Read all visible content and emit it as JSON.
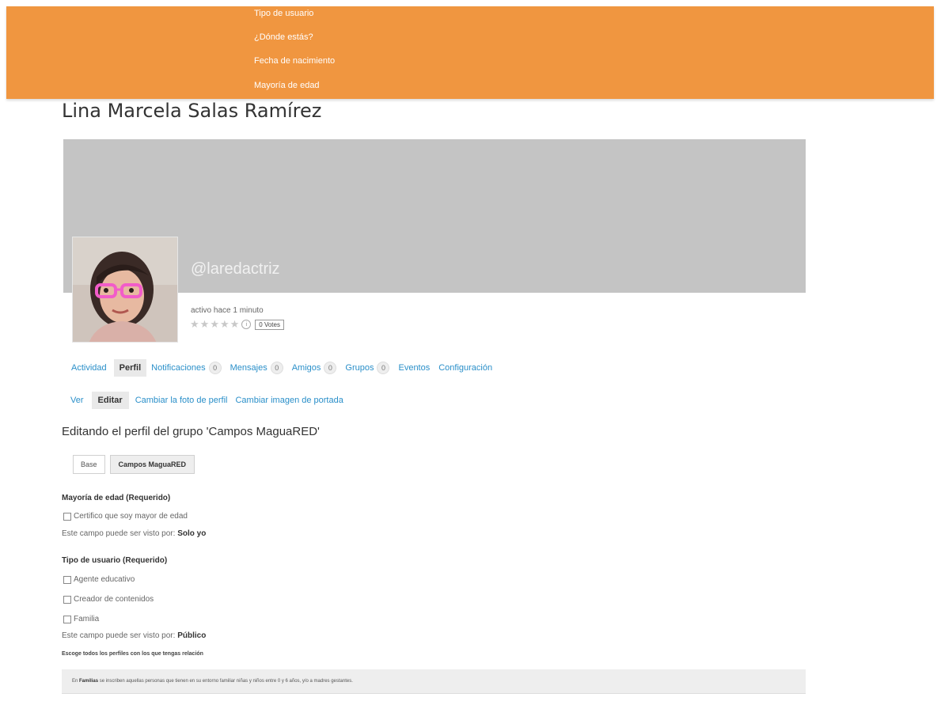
{
  "dropdown_menu": {
    "items": [
      "Tipo de usuario",
      "¿Dónde estás?",
      "Fecha de nacimiento",
      "Mayoría de edad"
    ]
  },
  "profile": {
    "name": "Lina Marcela Salas Ramírez",
    "handle": "@laredactriz",
    "last_active": "activo hace 1 minuto",
    "votes": "0 Votes"
  },
  "nav": {
    "items": [
      {
        "label": "Actividad"
      },
      {
        "label": "Perfil"
      },
      {
        "label": "Notificaciones",
        "count": "0"
      },
      {
        "label": "Mensajes",
        "count": "0"
      },
      {
        "label": "Amigos",
        "count": "0"
      },
      {
        "label": "Grupos",
        "count": "0"
      },
      {
        "label": "Eventos"
      },
      {
        "label": "Configuración"
      }
    ]
  },
  "subnav": {
    "items": [
      "Ver",
      "Editar",
      "Cambiar la foto de perfil",
      "Cambiar imagen de portada"
    ]
  },
  "editing_title": "Editando el perfil del grupo 'Campos MaguaRED'",
  "group_tabs": [
    "Base",
    "Campos MaguaRED"
  ],
  "fields": {
    "mayoria": {
      "label": "Mayoría de edad (Requerido)",
      "option": "Certifico que soy mayor de edad",
      "visibility_prefix": "Este campo puede ser visto por:",
      "visibility_value": "Solo yo"
    },
    "tipo": {
      "label": "Tipo de usuario (Requerido)",
      "options": [
        "Agente educativo",
        "Creador de contenidos",
        "Familia"
      ],
      "visibility_prefix": "Este campo puede ser visto por:",
      "visibility_value": "Público"
    }
  },
  "hint": "Escoge todos los perfiles con los que tengas relación",
  "info": {
    "prefix": "En",
    "bold": "Familias",
    "rest": "se inscriben aquellas personas que tienen en su entorno familiar niñas y niños entre 0 y 6 años, y/o a madres gestantes."
  },
  "colors": {
    "header": "#f09640",
    "link": "#2a8fc9",
    "cover": "#c4c4c4"
  }
}
